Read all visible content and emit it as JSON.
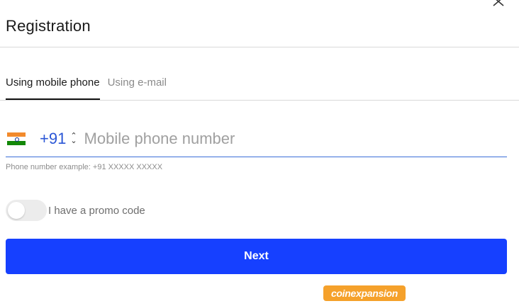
{
  "dialog": {
    "title": "Registration"
  },
  "tabs": [
    {
      "label": "Using mobile phone",
      "active": true
    },
    {
      "label": "Using e-mail",
      "active": false
    }
  ],
  "phone": {
    "country_flag": "india-flag",
    "country_code": "+91",
    "placeholder": "Mobile phone number",
    "value": "",
    "hint": "Phone number example: +91 XXXXX XXXXX"
  },
  "promo": {
    "label": "I have a promo code",
    "enabled": false
  },
  "actions": {
    "next_label": "Next"
  },
  "watermark": {
    "text": "coinexpansion"
  },
  "colors": {
    "primary_button": "#1640ff",
    "country_code_text": "#2a56d6",
    "input_underline": "#3a6fd8",
    "watermark_bg": "#f5a12b"
  }
}
